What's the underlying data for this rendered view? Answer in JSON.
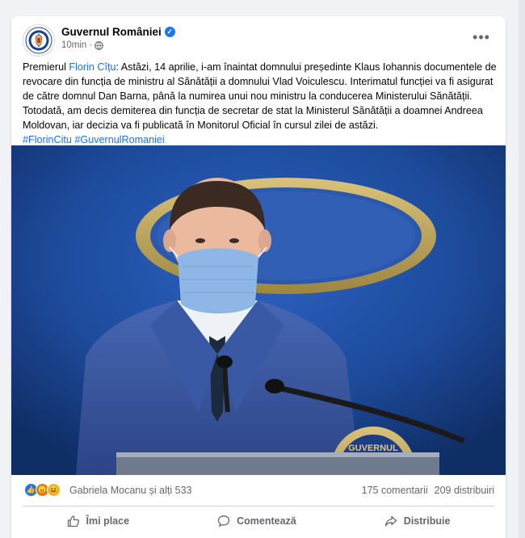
{
  "post": {
    "page_name": "Guvernul României",
    "time": "10min",
    "text_prefix": "Premierul ",
    "mention": "Florin Cîțu",
    "text_body": ": Astăzi, 14 aprilie, i-am înaintat domnului președinte Klaus Iohannis documentele de revocare din funcția de ministru al Sănătății a domnului Vlad Voiculescu. Interimatul funcției va fi asigurat de către domnul Dan Barna, până la numirea unui nou ministru la conducerea Ministerului Sănătății. Totodată, am decis demiterea din funcția de secretar de stat la Ministerul Sănătății a doamnei Andreea Moldovan, iar decizia va fi publicată în Monitorul Oficial în cursul zilei de astăzi.",
    "hashtag_1": "#FlorinCitu",
    "hashtag_2": "#GuvernulRomaniei"
  },
  "photo": {
    "seal_text": "GUVERNUL"
  },
  "stats": {
    "reactors": "Gabriela Mocanu și alți 533",
    "comments": "175 comentarii",
    "shares": "209 distribuiri"
  },
  "actions": {
    "like": "Îmi place",
    "comment": "Comentează",
    "share": "Distribuie"
  },
  "icons": {
    "verified": "verified-badge-icon",
    "globe": "globe-icon",
    "more": "more-options-icon",
    "like": "thumbs-up-icon",
    "comment": "speech-bubble-icon",
    "share": "share-arrow-icon"
  },
  "colors": {
    "link": "#216fdb",
    "background": "#f0f2f5",
    "secondary_text": "#65676b"
  }
}
